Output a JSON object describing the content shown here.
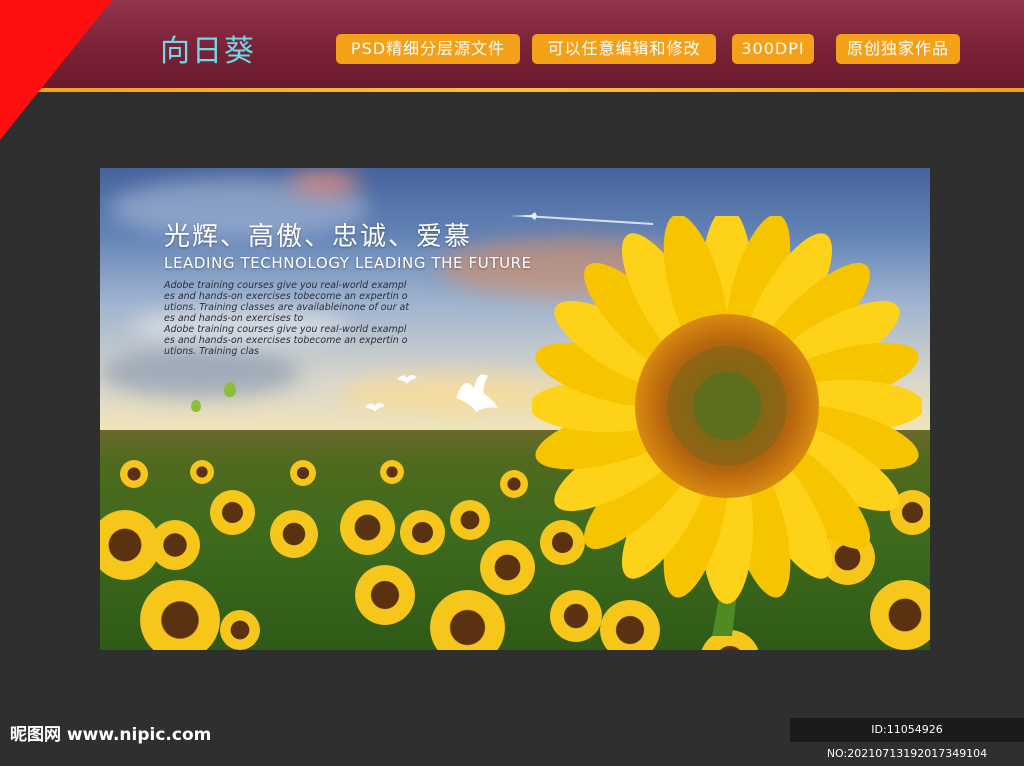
{
  "header": {
    "title": "向日葵",
    "badges": [
      "PSD精细分层源文件",
      "可以任意编辑和修改",
      "300DPI",
      "原创独家作品"
    ]
  },
  "poster": {
    "headline": "光辉、高傲、忠诚、爱慕",
    "tagline": "LEADING TECHNOLOGY LEADING THE FUTURE",
    "body_lines": [
      "Adobe training courses give you real-world exampl",
      "es and hands-on exercises tobecome an expertin o",
      "utions. Training classes are availableinone of our at",
      "es and hands-on exercises to",
      "Adobe training courses give you real-world exampl",
      "es and hands-on exercises tobecome an expertin o",
      "utions. Training clas"
    ]
  },
  "footer": {
    "site": "昵图网 www.nipic.com",
    "id_text": "ID:11054926 NO:20210713192017349104"
  },
  "colors": {
    "header_bg": "#7a2236",
    "accent_line": "#f5b12a",
    "badge_bg": "#f5a019",
    "title_color": "#6fd8ea",
    "page_bg": "#2f2f2f",
    "corner_red": "#ff0f0f"
  }
}
